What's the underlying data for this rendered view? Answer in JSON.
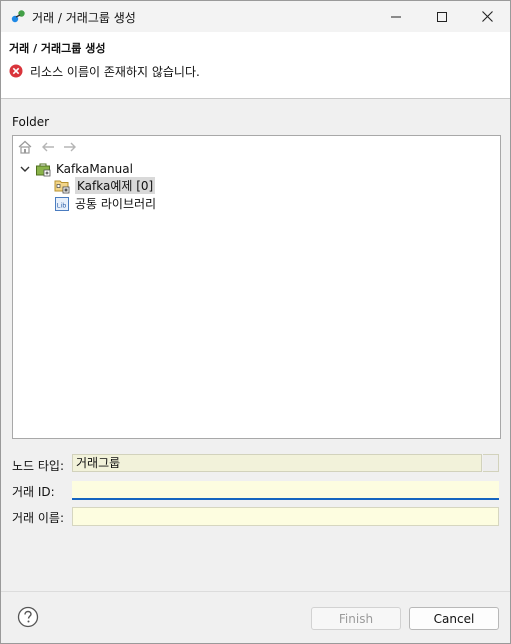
{
  "window": {
    "title": "거래 / 거래그룹 생성"
  },
  "header": {
    "title": "거래 / 거래그룹 생성",
    "error_message": "리소스 이름이 존재하지 않습니다."
  },
  "folder": {
    "label": "Folder",
    "tree": {
      "root": {
        "label": "KafkaManual",
        "icon": "project-icon",
        "expanded": true
      },
      "children": [
        {
          "label": "Kafka예제 [0]",
          "icon": "folder-group-icon",
          "selected": true
        },
        {
          "label": "공통 라이브러리",
          "icon": "library-icon",
          "selected": false
        }
      ]
    }
  },
  "form": {
    "node_type": {
      "label": "노드 타입:",
      "value": "거래그룹"
    },
    "txn_id": {
      "label": "거래 ID:",
      "value": ""
    },
    "txn_name": {
      "label": "거래 이름:",
      "value": ""
    }
  },
  "footer": {
    "finish_label": "Finish",
    "cancel_label": "Cancel"
  },
  "colors": {
    "focus_underline": "#1565c0",
    "field_bg": "#fdfde0",
    "error": "#d9343b"
  }
}
